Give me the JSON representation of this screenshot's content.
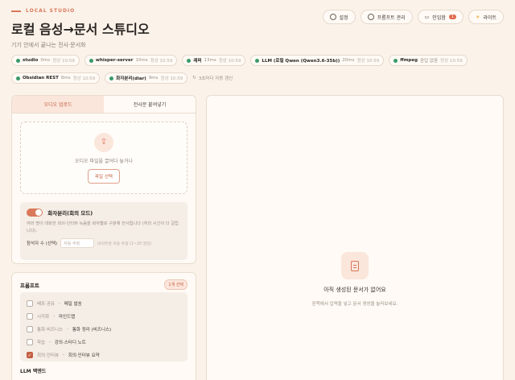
{
  "brand": {
    "label": "LOCAL STUDIO"
  },
  "header": {
    "title": "로컬 음성→문서 스튜디오",
    "subtitle": "기기 안에서 끝나는 전사·문서화"
  },
  "actions": {
    "settings": "설정",
    "prompts": "프롬프트 관리",
    "inbox": "인입함",
    "inbox_count": "1",
    "theme": "라이트"
  },
  "status": [
    {
      "name": "studio",
      "ms": "0ms",
      "state": "정상 10:59"
    },
    {
      "name": "whisper-server",
      "ms": "10ms",
      "state": "정상 10:59"
    },
    {
      "name": "래퍼",
      "ms": "13ms",
      "state": "정상 10:59"
    },
    {
      "name": "LLM (로컬 Qwen (Qwen3.6-35b))",
      "ms": "20ms",
      "state": "정상 10:59"
    },
    {
      "name": "ffmpeg",
      "ms": "응답 없음",
      "state": "정상 10:59"
    },
    {
      "name": "Obsidian REST",
      "ms": "8ms",
      "state": "정상 10:59"
    },
    {
      "name": "화자분리(diar)",
      "ms": "9ms",
      "state": "정상 10:59"
    }
  ],
  "refresh_text": "3초마다 자동 갱신",
  "upload": {
    "tab_audio": "오디오 업로드",
    "tab_paste": "전사문 붙여넣기",
    "drop_text": "오디오 파일을 끌어다 놓거나",
    "select_button": "파일 선택"
  },
  "diarization": {
    "title": "화자분리(회의 모드)",
    "desc": "여러 명이 대화한 회의·인터뷰 녹음을 화자별로 구분해 전사합니다 (처리 시간이 더 걸립니다).",
    "count_label": "참석자 수 (선택)",
    "count_placeholder": "자동 추정",
    "count_hint": "비워두면 자동 추정 (1~20 권장)"
  },
  "prompts": {
    "title": "프롬프트",
    "badge": "1개 선택",
    "items": [
      {
        "cat": "배포·공유",
        "name": "메일 발송",
        "checked": false
      },
      {
        "cat": "시각화",
        "name": "마인드맵",
        "checked": false
      },
      {
        "cat": "통화·비즈니스",
        "name": "통화 정리 (비즈니스)",
        "checked": false
      },
      {
        "cat": "학습",
        "name": "강의·스터디 노트",
        "checked": false
      },
      {
        "cat": "회의·인터뷰",
        "name": "회의·인터뷰 요약",
        "checked": true
      }
    ],
    "llm_label": "LLM 백엔드"
  },
  "empty": {
    "title": "아직 생성된 문서가 없어요",
    "desc": "왼쪽에서 입력을 넣고 문서 생성을 눌러보세요."
  }
}
